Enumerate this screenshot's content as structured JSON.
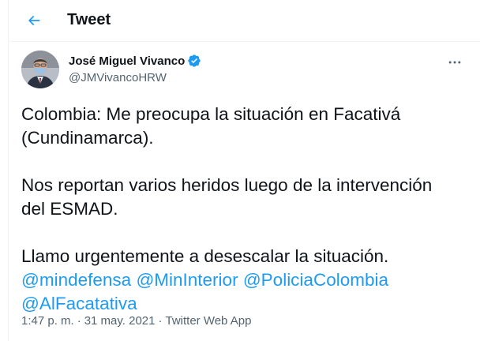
{
  "header": {
    "title": "Tweet"
  },
  "author": {
    "display_name": "José Miguel Vivanco",
    "handle": "@JMVivancoHRW",
    "verified": true
  },
  "tweet": {
    "lines": [
      "Colombia: Me preocupa la situación en Facativá\n(Cundinamarca).",
      "Nos reportan varios heridos luego de la intervención\ndel ESMAD.",
      "Llamo urgentemente a desescalar la situación."
    ],
    "mentions": [
      "@mindefensa",
      "@MinInterior",
      "@PoliciaColombia",
      "@AlFacatativa"
    ]
  },
  "meta": {
    "time": "1:47 p. m.",
    "separator": "·",
    "date": "31 may. 2021",
    "source": "Twitter Web App"
  },
  "colors": {
    "accent": "#1d9bf0",
    "secondary_text": "#536471",
    "primary_text": "#0f1419"
  },
  "icons": {
    "back": "arrow-left-icon",
    "verified": "verified-badge-icon",
    "more": "more-horizontal-icon"
  }
}
